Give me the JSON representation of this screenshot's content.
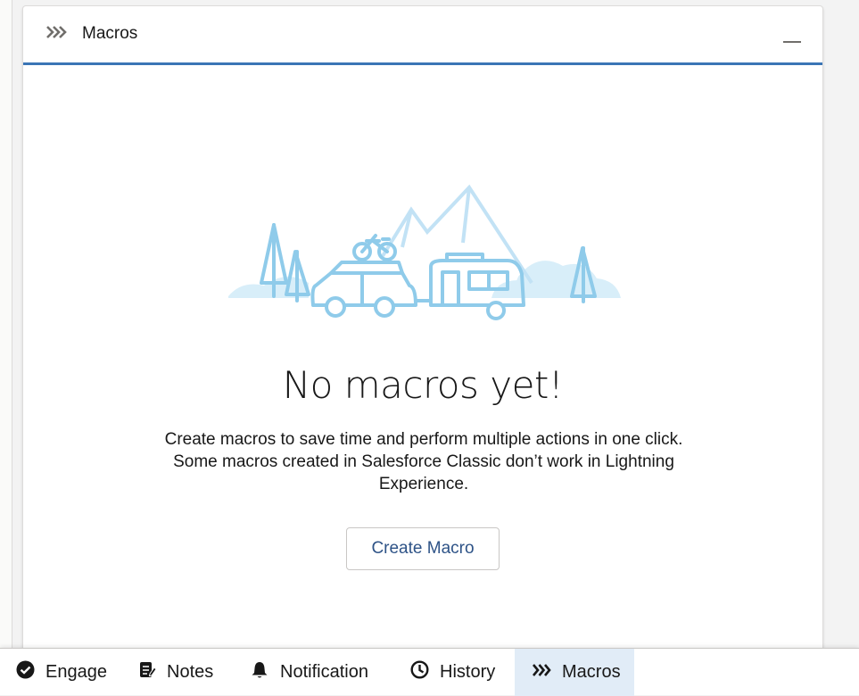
{
  "panel": {
    "title": "Macros",
    "header_icon": "macros-chevron-icon",
    "minimize_icon": "minimize-icon"
  },
  "empty_state": {
    "illustration": "camping-trailer-illustration",
    "title": "No macros yet!",
    "description": "Create macros to save time and perform multiple actions in one click. Some macros created in Salesforce Classic don’t work in Lightning Experience.",
    "button_label": "Create Macro"
  },
  "utility_bar": {
    "items": [
      {
        "label": "Engage",
        "icon": "check-circle-icon",
        "active": false
      },
      {
        "label": "Notes",
        "icon": "notes-icon",
        "active": false
      },
      {
        "label": "Notification",
        "icon": "bell-icon",
        "active": false
      },
      {
        "label": "History",
        "icon": "clock-icon",
        "active": false
      },
      {
        "label": "Macros",
        "icon": "macros-chevron-icon",
        "active": true
      }
    ]
  },
  "colors": {
    "header_border": "#3a75b5",
    "illustration_stroke": "#8fcbea",
    "illustration_fill": "#d8eef9",
    "active_tab": "#e1ecf7"
  }
}
